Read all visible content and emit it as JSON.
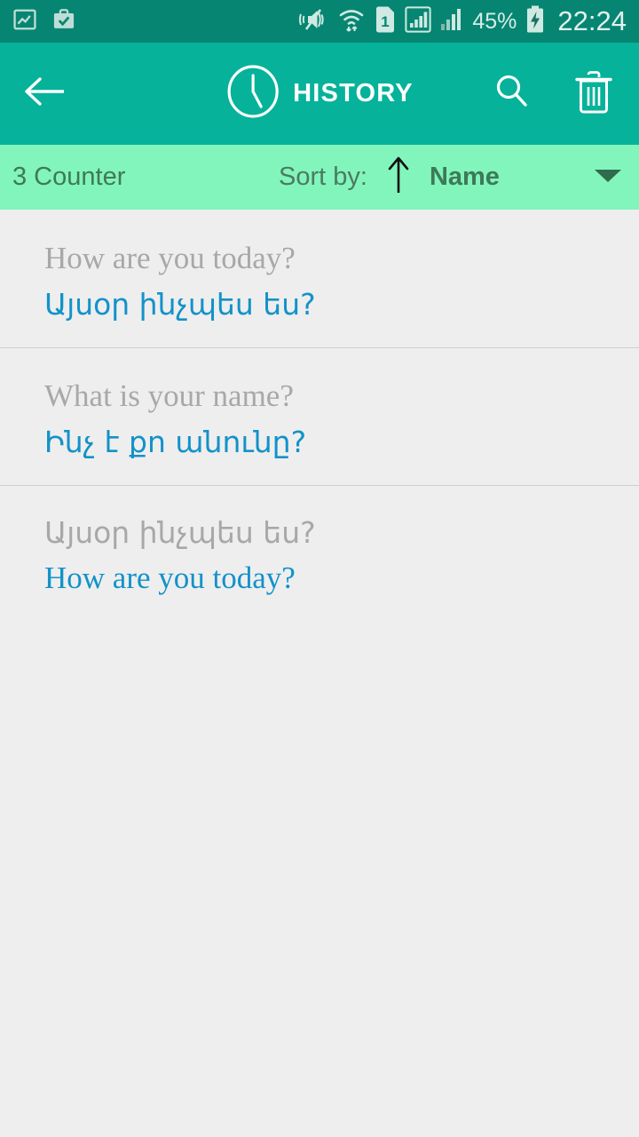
{
  "status_bar": {
    "background": "#068672",
    "left_icons": [
      {
        "name": "photo-gallery-icon",
        "label": "gallery"
      },
      {
        "name": "work-profile-briefcase-icon",
        "label": "work-profile"
      }
    ],
    "right_icons": [
      {
        "name": "vibrate-mute-icon",
        "label": "silent-vibrate"
      },
      {
        "name": "wifi-transfer-icon",
        "label": "wifi"
      },
      {
        "name": "sim-1-icon",
        "label": "SIM 1"
      },
      {
        "name": "signal-bars-boxed-icon",
        "label": "signal-1"
      },
      {
        "name": "signal-bars-icon",
        "label": "signal-2"
      }
    ],
    "battery_percent": "45%",
    "battery_icon": "battery-charging-icon",
    "time": "22:24"
  },
  "app_bar": {
    "background": "#06b29a",
    "back_icon": "arrow-left-icon",
    "title_icon": "clock-icon",
    "title": "HISTORY",
    "search_icon": "search-icon",
    "delete_icon": "trash-icon"
  },
  "sort_bar": {
    "background": "#82f5bc",
    "counter": "3 Counter",
    "sort_label": "Sort by:",
    "sort_direction_icon": "arrow-up-icon",
    "sort_field": "Name",
    "dropdown_icon": "chevron-down-icon"
  },
  "history": {
    "items": [
      {
        "source": "How are you today?",
        "source_script": "latin",
        "target": "Այսօր ինչպես ես?",
        "target_script": "armenian"
      },
      {
        "source": "What is your name?",
        "source_script": "latin",
        "target": "Ինչ է քո անունը?",
        "target_script": "armenian"
      },
      {
        "source": "Այսօր ինչպես ես?",
        "source_script": "armenian",
        "target": "How are you today?",
        "target_script": "latin"
      }
    ]
  },
  "colors": {
    "status_bar": "#068672",
    "app_bar": "#06b29a",
    "sort_bar": "#82f5bc",
    "page_background": "#eeeeee",
    "source_text": "#a8a8a8",
    "target_text": "#1392c9",
    "divider": "#cfcfcf"
  }
}
